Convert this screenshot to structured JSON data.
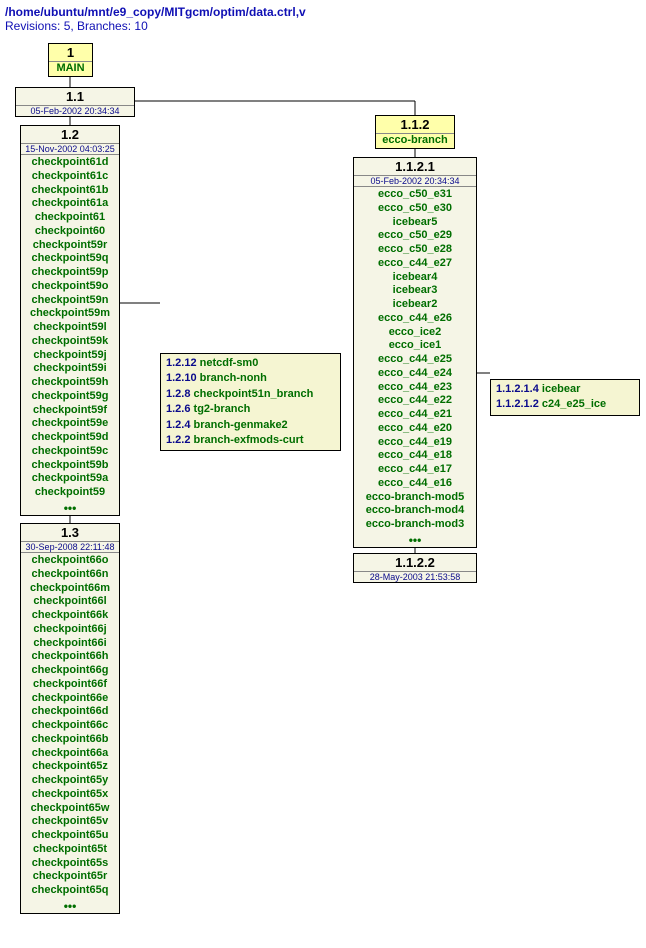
{
  "header": {
    "path": "/home/ubuntu/mnt/e9_copy/MITgcm/optim/data.ctrl,v",
    "stats": "Revisions: 5, Branches: 10"
  },
  "root": {
    "rev": "1",
    "label": "MAIN"
  },
  "r11": {
    "rev": "1.1",
    "date": "05-Feb-2002 20:34:34"
  },
  "r12": {
    "rev": "1.2",
    "date": "15-Nov-2002 04:03:25",
    "tags": [
      "checkpoint61d",
      "checkpoint61c",
      "checkpoint61b",
      "checkpoint61a",
      "checkpoint61",
      "checkpoint60",
      "checkpoint59r",
      "checkpoint59q",
      "checkpoint59p",
      "checkpoint59o",
      "checkpoint59n",
      "checkpoint59m",
      "checkpoint59l",
      "checkpoint59k",
      "checkpoint59j",
      "checkpoint59i",
      "checkpoint59h",
      "checkpoint59g",
      "checkpoint59f",
      "checkpoint59e",
      "checkpoint59d",
      "checkpoint59c",
      "checkpoint59b",
      "checkpoint59a",
      "checkpoint59"
    ]
  },
  "r13": {
    "rev": "1.3",
    "date": "30-Sep-2008 22:11:48",
    "tags": [
      "checkpoint66o",
      "checkpoint66n",
      "checkpoint66m",
      "checkpoint66l",
      "checkpoint66k",
      "checkpoint66j",
      "checkpoint66i",
      "checkpoint66h",
      "checkpoint66g",
      "checkpoint66f",
      "checkpoint66e",
      "checkpoint66d",
      "checkpoint66c",
      "checkpoint66b",
      "checkpoint66a",
      "checkpoint65z",
      "checkpoint65y",
      "checkpoint65x",
      "checkpoint65w",
      "checkpoint65v",
      "checkpoint65u",
      "checkpoint65t",
      "checkpoint65s",
      "checkpoint65r",
      "checkpoint65q"
    ]
  },
  "branches12": [
    {
      "v": "1.2.12",
      "n": "netcdf-sm0"
    },
    {
      "v": "1.2.10",
      "n": "branch-nonh"
    },
    {
      "v": "1.2.8",
      "n": "checkpoint51n_branch"
    },
    {
      "v": "1.2.6",
      "n": "tg2-branch"
    },
    {
      "v": "1.2.4",
      "n": "branch-genmake2"
    },
    {
      "v": "1.2.2",
      "n": "branch-exfmods-curt"
    }
  ],
  "ecco_head": {
    "rev": "1.1.2",
    "label": "ecco-branch"
  },
  "r1121": {
    "rev": "1.1.2.1",
    "date": "05-Feb-2002 20:34:34",
    "tags": [
      "ecco_c50_e31",
      "ecco_c50_e30",
      "icebear5",
      "ecco_c50_e29",
      "ecco_c50_e28",
      "ecco_c44_e27",
      "icebear4",
      "icebear3",
      "icebear2",
      "ecco_c44_e26",
      "ecco_ice2",
      "ecco_ice1",
      "ecco_c44_e25",
      "ecco_c44_e24",
      "ecco_c44_e23",
      "ecco_c44_e22",
      "ecco_c44_e21",
      "ecco_c44_e20",
      "ecco_c44_e19",
      "ecco_c44_e18",
      "ecco_c44_e17",
      "ecco_c44_e16",
      "ecco-branch-mod5",
      "ecco-branch-mod4",
      "ecco-branch-mod3"
    ]
  },
  "r1122": {
    "rev": "1.1.2.2",
    "date": "28-May-2003 21:53:58"
  },
  "branches1121": [
    {
      "v": "1.1.2.1.4",
      "n": "icebear"
    },
    {
      "v": "1.1.2.1.2",
      "n": "c24_e25_ice"
    }
  ]
}
